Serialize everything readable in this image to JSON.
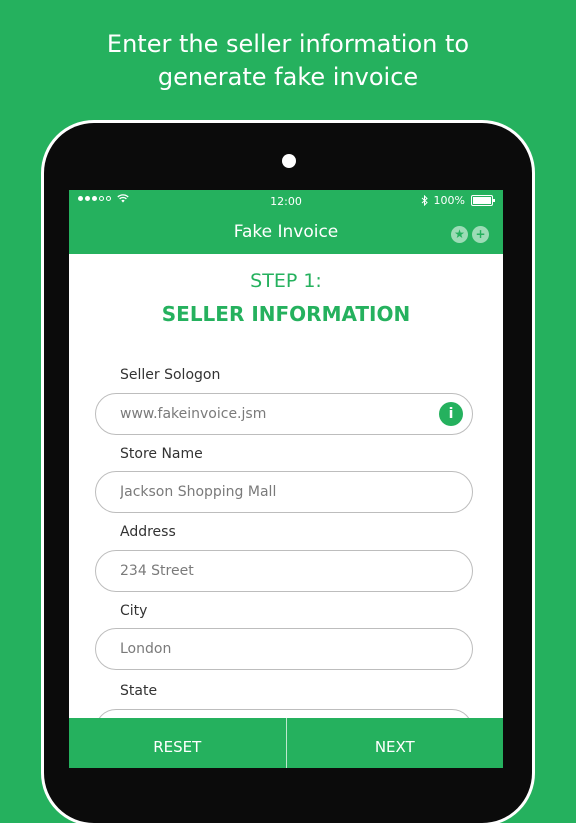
{
  "headline": {
    "line1": "Enter the seller information to",
    "line2": "generate fake invoice"
  },
  "status_bar": {
    "time": "12:00",
    "battery": "100%",
    "icons": [
      "signal-dots-icon",
      "wifi-icon",
      "bluetooth-icon",
      "battery-icon"
    ]
  },
  "nav": {
    "title": "Fake Invoice",
    "star_icon": "★",
    "plus_icon": "+"
  },
  "step": {
    "label": "STEP 1:",
    "title": "SELLER INFORMATION"
  },
  "fields": {
    "seller_slogan": {
      "label": "Seller Sologon",
      "value": "www.fakeinvoice.jsm",
      "info_icon": "i"
    },
    "store_name": {
      "label": "Store Name",
      "value": "Jackson Shopping Mall"
    },
    "address": {
      "label": "Address",
      "value": "234 Street"
    },
    "city": {
      "label": "City",
      "value": "London"
    },
    "state": {
      "label": "State",
      "value": ""
    }
  },
  "buttons": {
    "reset": "RESET",
    "next": "NEXT"
  },
  "colors": {
    "brand": "#25b15e",
    "device": "#0b0b0b"
  }
}
